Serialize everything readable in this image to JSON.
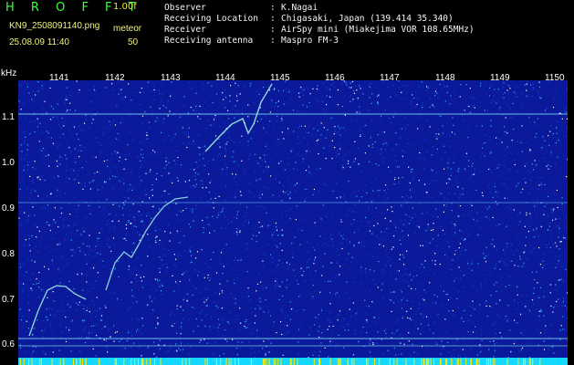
{
  "header": {
    "app_title": "H R O F F T",
    "version": "1.00f",
    "filename": "KN9_2508091140.png",
    "mode": "meteor",
    "timestamp": "25.08.09 11:40",
    "count": "50"
  },
  "info": {
    "rows": [
      {
        "label": "Observer",
        "value": "K.Nagai"
      },
      {
        "label": "Receiving Location",
        "value": "Chigasaki, Japan (139.414 35.340)"
      },
      {
        "label": "Receiver",
        "value": "AirSpy mini (Miakejima VOR 108.65MHz)"
      },
      {
        "label": "Receiving antenna",
        "value": "Maspro FM-3"
      }
    ],
    "separator": ":"
  },
  "spectrogram": {
    "unit_label": "kHz",
    "y_ticks": [
      "1.1",
      "1.0",
      "0.9",
      "0.8",
      "0.7",
      "0.6"
    ],
    "x_ticks": [
      "1141",
      "1142",
      "1143",
      "1144",
      "1145",
      "1146",
      "1147",
      "1148",
      "1149",
      "1150"
    ],
    "colors": {
      "background": "#0a1a9a",
      "noise_low": "#1a3fd8",
      "noise_mid": "#3aa8ff",
      "noise_high": "#ffffff",
      "trace": "#9ef0e0",
      "baseline": "#00d8ff",
      "tick": "#ffe600"
    }
  }
}
